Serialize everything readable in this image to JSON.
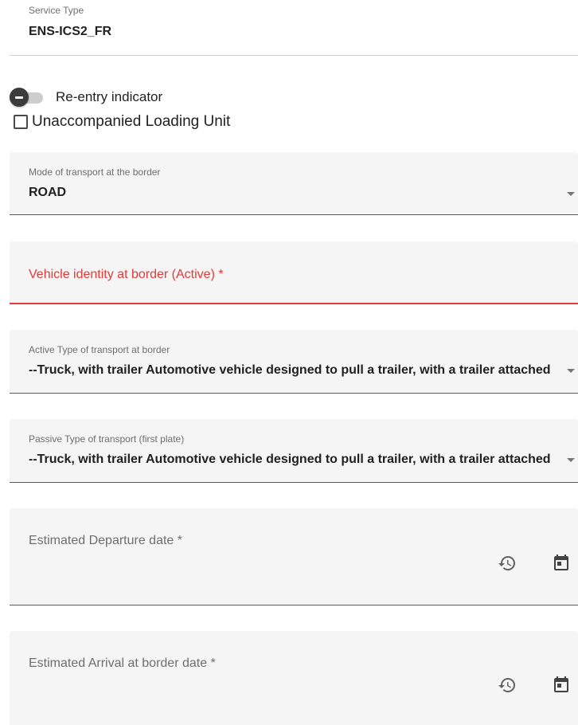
{
  "service_type": {
    "label": "Service Type",
    "value": "ENS-ICS2_FR"
  },
  "reentry": {
    "label": "Re-entry indicator",
    "checked": false
  },
  "unaccompanied": {
    "label": "Unaccompanied Loading Unit",
    "checked": false
  },
  "mode_of_transport": {
    "label": "Mode of transport at the border",
    "value": "ROAD"
  },
  "vehicle_identity": {
    "label": "Vehicle identity at border (Active) *",
    "value": ""
  },
  "active_type": {
    "label": "Active Type of transport at border",
    "value": "--Truck, with trailer Automotive vehicle designed to pull a trailer, with a trailer attached"
  },
  "passive_type": {
    "label": "Passive Type of transport (first plate)",
    "value": "--Truck, with trailer Automotive vehicle designed to pull a trailer, with a trailer attached"
  },
  "departure_date": {
    "label": "Estimated Departure date *",
    "value": ""
  },
  "arrival_date": {
    "label": "Estimated Arrival at border date *",
    "value": ""
  },
  "icons": {
    "history": "history-icon",
    "calendar": "calendar-icon",
    "dropdown": "chevron-down-icon"
  },
  "colors": {
    "error": "#e53935",
    "field_bg": "#f5f5f5",
    "label": "#6e6e6e"
  }
}
